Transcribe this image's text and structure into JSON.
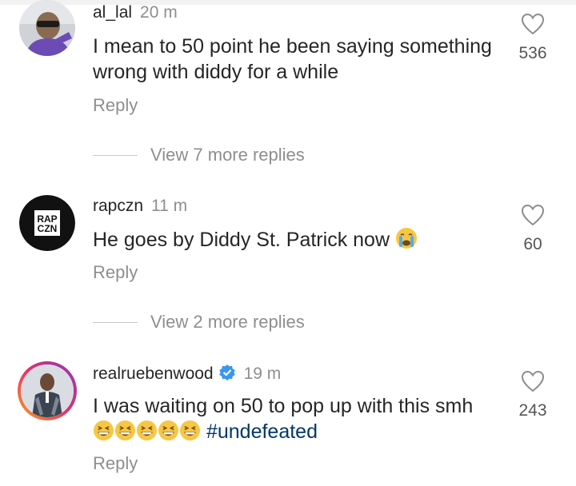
{
  "comments": [
    {
      "username": "al_lal",
      "time": "20 m",
      "text": "I mean to 50 point he been saying something wrong with diddy for a while",
      "reply_label": "Reply",
      "likes": "536",
      "view_replies": "View 7 more replies"
    },
    {
      "username": "rapczn",
      "time": "11 m",
      "text": "He goes by Diddy St. Patrick now",
      "reply_label": "Reply",
      "likes": "60",
      "view_replies": "View 2 more replies",
      "avatar_text_1": "RAP",
      "avatar_text_2": "CZN"
    },
    {
      "username": "realruebenwood",
      "time": "19 m",
      "text": "I was waiting on 50 to pop up with this smh",
      "hashtag": "#undefeated",
      "reply_label": "Reply",
      "likes": "243"
    }
  ],
  "colors": {
    "link": "#00376b",
    "secondary": "#8e8e8e",
    "verified": "#3897f0"
  }
}
